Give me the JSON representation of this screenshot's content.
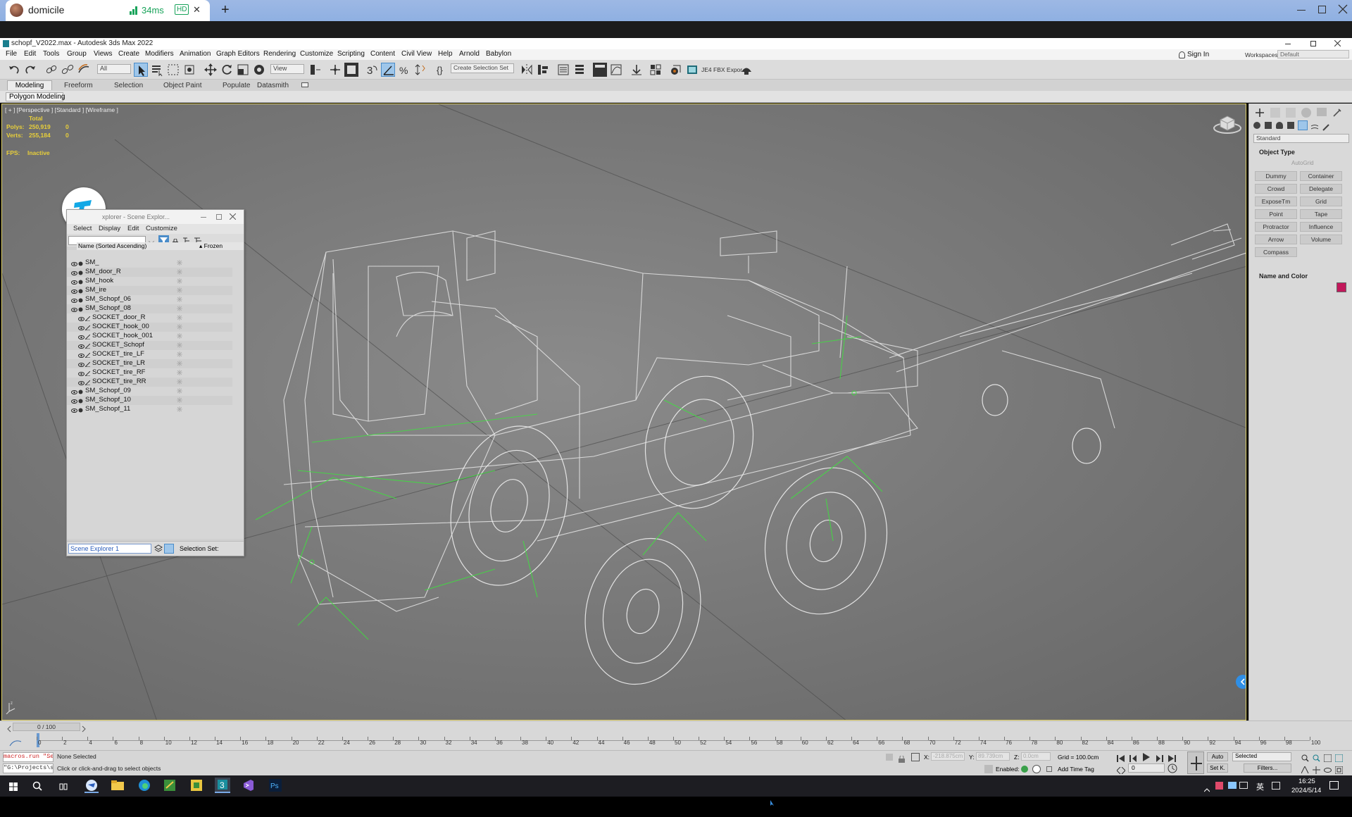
{
  "browser": {
    "tab_title": "domicile",
    "latency": "34ms",
    "hd_badge": "HD",
    "tab_close": "✕",
    "new_tab": "+"
  },
  "max": {
    "window_title": "schopf_V2022.max - Autodesk 3ds Max 2022",
    "menu": [
      "File",
      "Edit",
      "Tools",
      "Group",
      "Views",
      "Create",
      "Modifiers",
      "Animation",
      "Graph Editors",
      "Rendering",
      "Customize",
      "Scripting",
      "Content",
      "Civil View",
      "Help",
      "Arnold",
      "Babylon"
    ],
    "sign_in": "Sign In",
    "workspaces_label": "Workspaces:",
    "workspaces_value": "Default",
    "selection_filter": "All",
    "ref_coord": "View",
    "named_selection": "Create Selection Set",
    "fbx_label": "JE4 FBX Expor",
    "ribbon_tabs": [
      "Modeling",
      "Freeform",
      "Selection",
      "Object Paint",
      "Populate",
      "Datasmith"
    ],
    "ribbon_sub": "Polygon Modeling"
  },
  "viewport": {
    "label": "[ + ] [Perspective ] [Standard ] [Wireframe ]",
    "stats_total": "Total",
    "polys_label": "Polys:",
    "polys_value": "250,919",
    "polys_sel": "0",
    "verts_label": "Verts:",
    "verts_value": "255,184",
    "verts_sel": "0",
    "fps_label": "FPS:",
    "fps_value": "Inactive"
  },
  "scene_explorer": {
    "title": "Scene Explorer 1 - Scene Explor...",
    "title_visible": "xplorer - Scene Explor...",
    "menu": [
      "Select",
      "Display",
      "Edit",
      "Customize"
    ],
    "col_name": "Name (Sorted Ascending)",
    "col_frozen": "▴ Frozen",
    "rows": [
      {
        "name": "SM_",
        "indent": 0
      },
      {
        "name": "SM_door_R",
        "indent": 0
      },
      {
        "name": "SM_hook",
        "indent": 0
      },
      {
        "name": "SM_ire",
        "indent": 0
      },
      {
        "name": "SM_Schopf_06",
        "indent": 0
      },
      {
        "name": "SM_Schopf_08",
        "indent": 0
      },
      {
        "name": "SOCKET_door_R",
        "indent": 1
      },
      {
        "name": "SOCKET_hook_00",
        "indent": 1
      },
      {
        "name": "SOCKET_hook_001",
        "indent": 1
      },
      {
        "name": "SOCKET_Schopf",
        "indent": 1
      },
      {
        "name": "SOCKET_tire_LF",
        "indent": 1
      },
      {
        "name": "SOCKET_tire_LR",
        "indent": 1
      },
      {
        "name": "SOCKET_tire_RF",
        "indent": 1
      },
      {
        "name": "SOCKET_tire_RR",
        "indent": 1
      },
      {
        "name": "SM_Schopf_09",
        "indent": 0
      },
      {
        "name": "SM_Schopf_10",
        "indent": 0
      },
      {
        "name": "SM_Schopf_11",
        "indent": 0
      }
    ],
    "footer_name": "Scene Explorer 1",
    "footer_selset": "Selection Set:"
  },
  "command_panel": {
    "category": "Standard",
    "object_type_header": "Object Type",
    "autogrid": "AutoGrid",
    "buttons": [
      "Dummy",
      "Container",
      "Crowd",
      "Delegate",
      "ExposeTm",
      "Grid",
      "Point",
      "Tape",
      "Protractor",
      "Influence",
      "Arrow",
      "Volume",
      "Compass"
    ],
    "name_color_header": "Name and Color",
    "object_color": "#c2185b"
  },
  "timeline": {
    "frame": "0 / 100",
    "ticks": [
      "0",
      "2",
      "4",
      "6",
      "8",
      "10",
      "12",
      "14",
      "16",
      "18",
      "20",
      "22",
      "24",
      "26",
      "28",
      "30",
      "32",
      "34",
      "36",
      "38",
      "40",
      "42",
      "44",
      "46",
      "48",
      "50",
      "52",
      "54",
      "56",
      "58",
      "60",
      "62",
      "64",
      "66",
      "68",
      "70",
      "72",
      "74",
      "76",
      "78",
      "80",
      "82",
      "84",
      "86",
      "88",
      "90",
      "92",
      "94",
      "96",
      "98",
      "100"
    ]
  },
  "status": {
    "maxscript_line1": "macros.run \"Sel",
    "maxscript_line2": "\"G:\\Projects\\s",
    "selection_info": "None Selected",
    "prompt": "Click or click-and-drag to select objects",
    "x_label": "X:",
    "x_value": "-218.875cm",
    "y_label": "Y:",
    "y_value": "89.739cm",
    "z_label": "Z:",
    "z_value": "0.0cm",
    "grid": "Grid = 100.0cm",
    "enabled_label": "Enabled:",
    "add_time_tag": "Add Time Tag",
    "auto_key": "Auto",
    "set_key": "Set K.",
    "key_filter": "Selected",
    "filters": "Filters...",
    "frame_spinner": "0"
  },
  "taskbar": {
    "ime": "英",
    "time": "16:25",
    "date": "2024/5/14"
  },
  "colors": {
    "viewport_border": "#e2d36a",
    "stats_yellow": "#e8cf3a",
    "wire_white": "#eeeeee",
    "wire_green": "#3fe03f",
    "ms_red": "#cc2222"
  }
}
